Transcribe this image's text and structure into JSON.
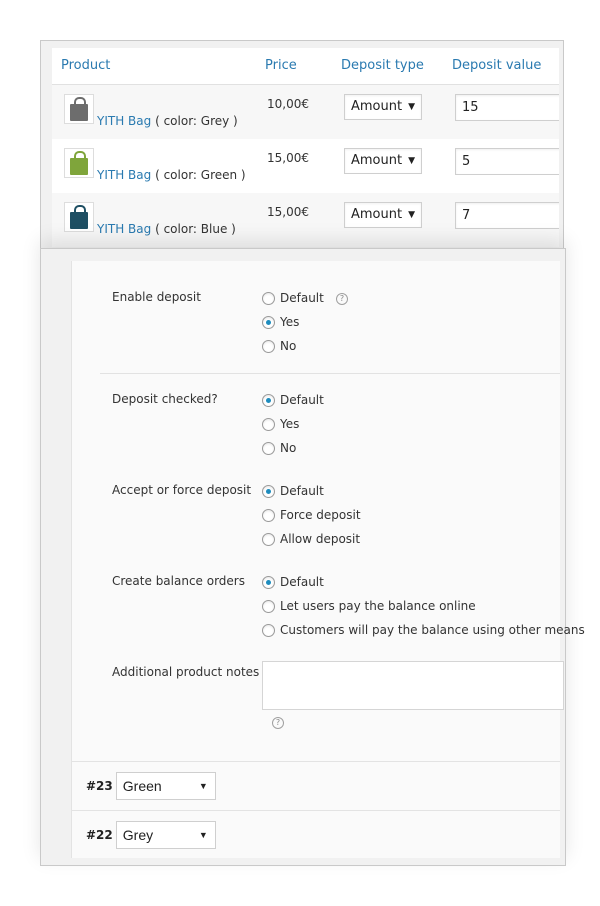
{
  "table": {
    "headers": {
      "product": "Product",
      "price": "Price",
      "deposit_type": "Deposit type",
      "deposit_value": "Deposit value"
    },
    "rows": [
      {
        "product": "YITH Bag",
        "variation": "( color: Grey )",
        "price": "10,00€",
        "deposit_type": "Amount",
        "deposit_value": "15",
        "thumb_color": "#6d6d6d"
      },
      {
        "product": "YITH Bag",
        "variation": "( color: Green )",
        "price": "15,00€",
        "deposit_type": "Amount",
        "deposit_value": "5",
        "thumb_color": "#7fa53b"
      },
      {
        "product": "YITH Bag",
        "variation": "( color: Blue )",
        "price": "15,00€",
        "deposit_type": "Amount",
        "deposit_value": "7",
        "thumb_color": "#1e4f63"
      }
    ]
  },
  "settings": {
    "enable_deposit": {
      "label": "Enable deposit",
      "options": [
        "Default",
        "Yes",
        "No"
      ],
      "selected": "Yes"
    },
    "deposit_checked": {
      "label": "Deposit checked?",
      "options": [
        "Default",
        "Yes",
        "No"
      ],
      "selected": "Default"
    },
    "accept_force": {
      "label": "Accept or force deposit",
      "options": [
        "Default",
        "Force deposit",
        "Allow deposit"
      ],
      "selected": "Default"
    },
    "balance_orders": {
      "label": "Create balance orders",
      "options": [
        "Default",
        "Let users pay the balance online",
        "Customers will pay the balance using other means"
      ],
      "selected": "Default"
    },
    "notes": {
      "label": "Additional product notes",
      "value": ""
    }
  },
  "variations": [
    {
      "id": "#23",
      "value": "Green"
    },
    {
      "id": "#22",
      "value": "Grey"
    }
  ],
  "icons": {
    "help": "?",
    "caret": "▼"
  },
  "colors": {
    "link": "#2a7ab0",
    "radio_active": "#1e8cbe"
  }
}
